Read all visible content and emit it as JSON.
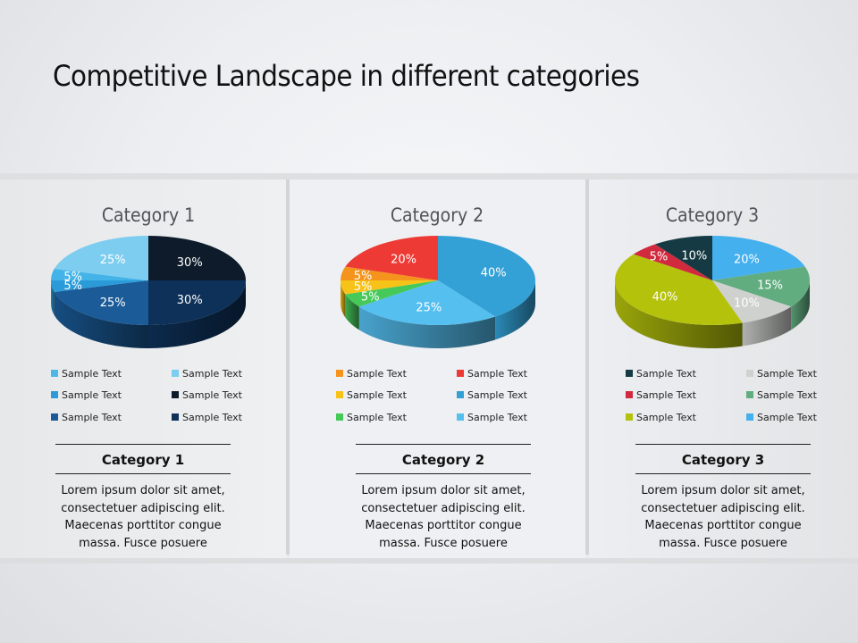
{
  "title": "Competitive Landscape in different categories",
  "chart_data": [
    {
      "type": "pie",
      "title": "Category 1",
      "slices": [
        {
          "label": "Sample Text",
          "value": 30,
          "display": "30%",
          "color": "#0d1b2a"
        },
        {
          "label": "Sample Text",
          "value": 30,
          "display": "30%",
          "color": "#0e3159"
        },
        {
          "label": "Sample Text",
          "value": 25,
          "display": "25%",
          "color": "#1a5b98"
        },
        {
          "label": "Sample Text",
          "value": 5,
          "display": "5%",
          "color": "#2a9bd8"
        },
        {
          "label": "Sample Text",
          "value": 5,
          "display": "5%",
          "color": "#43b3e8"
        },
        {
          "label": "Sample Text",
          "value": 25,
          "display": "25%",
          "color": "#7dcdf0"
        }
      ],
      "legend": [
        {
          "label": "Sample Text",
          "color": "#4db8e8"
        },
        {
          "label": "Sample Text",
          "color": "#7dcdf0"
        },
        {
          "label": "Sample Text",
          "color": "#2a9bd8"
        },
        {
          "label": "Sample Text",
          "color": "#0d1b2a"
        },
        {
          "label": "Sample Text",
          "color": "#1a5b98"
        },
        {
          "label": "Sample Text",
          "color": "#0e3159"
        }
      ]
    },
    {
      "type": "pie",
      "title": "Category 2",
      "slices": [
        {
          "label": "Sample Text",
          "value": 40,
          "display": "40%",
          "color": "#33a1d6"
        },
        {
          "label": "Sample Text",
          "value": 25,
          "display": "25%",
          "color": "#55bff0"
        },
        {
          "label": "Sample Text",
          "value": 5,
          "display": "5%",
          "color": "#47c95a"
        },
        {
          "label": "Sample Text",
          "value": 5,
          "display": "5%",
          "color": "#f7c318"
        },
        {
          "label": "Sample Text",
          "value": 5,
          "display": "5%",
          "color": "#f5941c"
        },
        {
          "label": "Sample Text",
          "value": 20,
          "display": "20%",
          "color": "#ee3a34"
        }
      ],
      "legend": [
        {
          "label": "Sample Text",
          "color": "#f5941c"
        },
        {
          "label": "Sample Text",
          "color": "#ee3a34"
        },
        {
          "label": "Sample Text",
          "color": "#f7c318"
        },
        {
          "label": "Sample Text",
          "color": "#33a1d6"
        },
        {
          "label": "Sample Text",
          "color": "#47c95a"
        },
        {
          "label": "Sample Text",
          "color": "#55bff0"
        }
      ]
    },
    {
      "type": "pie",
      "title": "Category 3",
      "slices": [
        {
          "label": "Sample Text",
          "value": 20,
          "display": "20%",
          "color": "#44b0ee"
        },
        {
          "label": "Sample Text",
          "value": 15,
          "display": "15%",
          "color": "#62ad80"
        },
        {
          "label": "Sample Text",
          "value": 10,
          "display": "10%",
          "color": "#cfd1cf"
        },
        {
          "label": "Sample Text",
          "value": 40,
          "display": "40%",
          "color": "#b4c20c"
        },
        {
          "label": "Sample Text",
          "value": 5,
          "display": "5%",
          "color": "#d12a3e"
        },
        {
          "label": "Sample Text",
          "value": 10,
          "display": "10%",
          "color": "#163a43"
        }
      ],
      "legend": [
        {
          "label": "Sample Text",
          "color": "#163a43"
        },
        {
          "label": "Sample Text",
          "color": "#cfd1cf"
        },
        {
          "label": "Sample Text",
          "color": "#d12a3e"
        },
        {
          "label": "Sample Text",
          "color": "#62ad80"
        },
        {
          "label": "Sample Text",
          "color": "#b4c20c"
        },
        {
          "label": "Sample Text",
          "color": "#44b0ee"
        }
      ]
    }
  ],
  "panels": [
    {
      "heading": "Category 1",
      "body": [
        "Lorem ipsum dolor sit amet,",
        "consectetuer adipiscing elit.",
        "Maecenas porttitor  congue",
        "massa. Fusce posuere"
      ]
    },
    {
      "heading": "Category 2",
      "body": [
        "Lorem ipsum dolor sit amet,",
        "consectetuer adipiscing elit.",
        "Maecenas porttitor  congue",
        "massa. Fusce posuere"
      ]
    },
    {
      "heading": "Category 3",
      "body": [
        "Lorem ipsum dolor sit amet,",
        "consectetuer adipiscing elit.",
        "Maecenas porttitor  congue",
        "massa. Fusce posuere"
      ]
    }
  ]
}
